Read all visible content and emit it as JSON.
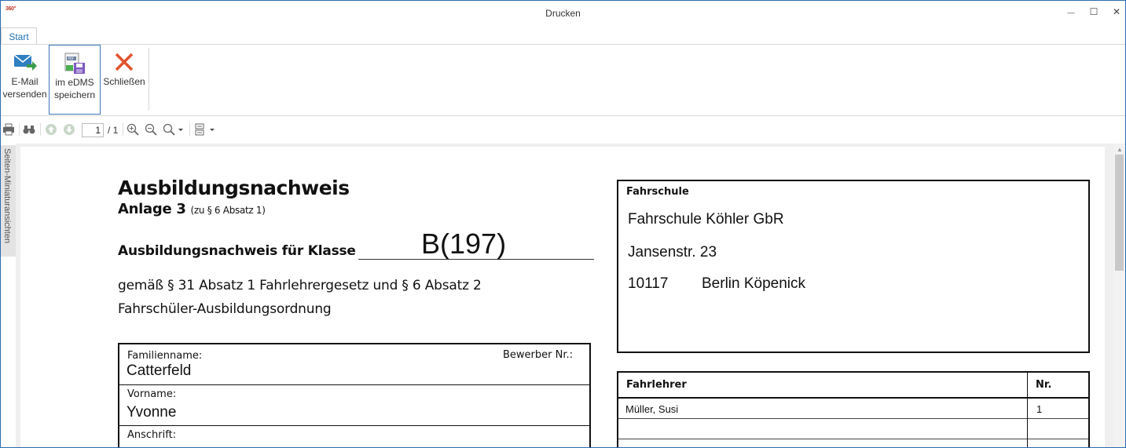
{
  "window": {
    "title": "Drucken",
    "app_icon_text": "360°",
    "minimize_glyph": "—",
    "maximize_glyph": "☐",
    "close_glyph": "✕"
  },
  "ribbon": {
    "tab": "Start",
    "buttons": [
      {
        "icon": "email-send-icon",
        "line1": "E-Mail",
        "line2": "versenden"
      },
      {
        "icon": "save-edms-icon",
        "line1": "im eDMS",
        "line2": "speichern"
      },
      {
        "icon": "close-x-icon",
        "line1": "Schließen",
        "line2": ""
      }
    ]
  },
  "toolbar": {
    "page_current": "1",
    "page_total": "/ 1"
  },
  "side_panel": {
    "label": "Seiten-Miniaturansichten"
  },
  "document": {
    "title": "Ausbildungsnachweis",
    "subtitle": "Anlage 3",
    "subtitle_note": "(zu § 6 Absatz 1)",
    "klasse_label": "Ausbildungsnachweis für Klasse",
    "klasse_value": "B(197)",
    "gemaess_line1": "gemäß § 31 Absatz 1 Fahrlehrergesetz und § 6 Absatz 2",
    "gemaess_line2": "Fahrschüler-Ausbildungsordnung",
    "person": {
      "familienname_label": "Familienname:",
      "familienname_value": "Catterfeld",
      "bewerber_label": "Bewerber Nr.:",
      "vorname_label": "Vorname:",
      "vorname_value": "Yvonne",
      "anschrift_label": "Anschrift:"
    },
    "fahrschule": {
      "label": "Fahrschule",
      "name": "Fahrschule Köhler GbR",
      "street": "Jansenstr. 23",
      "zip": "10117",
      "city": "Berlin Köpenick"
    },
    "fahrlehrer": {
      "header_name": "Fahrlehrer",
      "header_nr": "Nr.",
      "rows": [
        {
          "name": "Müller, Susi",
          "nr": "1"
        },
        {
          "name": "",
          "nr": ""
        },
        {
          "name": "",
          "nr": ""
        }
      ]
    }
  }
}
